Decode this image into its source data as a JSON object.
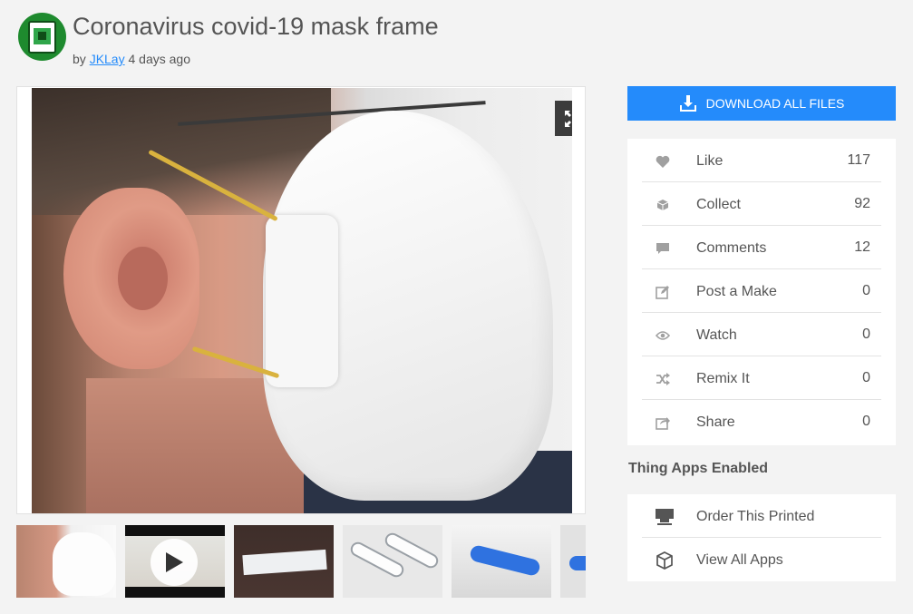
{
  "header": {
    "title": "Coronavirus covid-19 mask frame",
    "by_label": "by",
    "author": "JKLay",
    "posted": "4 days ago"
  },
  "gallery": {
    "expand_icon": "expand-arrows-icon",
    "thumbnails": [
      {
        "kind": "photo"
      },
      {
        "kind": "video",
        "icon": "play-icon"
      },
      {
        "kind": "photo"
      },
      {
        "kind": "render"
      },
      {
        "kind": "render"
      },
      {
        "kind": "render"
      }
    ]
  },
  "download": {
    "label": "DOWNLOAD ALL FILES",
    "icon": "download-icon",
    "color": "#248bfb"
  },
  "stats": [
    {
      "label": "Like",
      "count": "117",
      "icon": "heart-icon"
    },
    {
      "label": "Collect",
      "count": "92",
      "icon": "collect-icon"
    },
    {
      "label": "Comments",
      "count": "12",
      "icon": "comment-icon"
    },
    {
      "label": "Post a Make",
      "count": "0",
      "icon": "edit-icon"
    },
    {
      "label": "Watch",
      "count": "0",
      "icon": "eye-icon"
    },
    {
      "label": "Remix It",
      "count": "0",
      "icon": "shuffle-icon"
    },
    {
      "label": "Share",
      "count": "0",
      "icon": "share-icon"
    }
  ],
  "apps": {
    "title": "Thing Apps Enabled",
    "items": [
      {
        "label": "Order This Printed",
        "icon": "printer-icon"
      },
      {
        "label": "View All Apps",
        "icon": "cube-icon"
      }
    ]
  }
}
